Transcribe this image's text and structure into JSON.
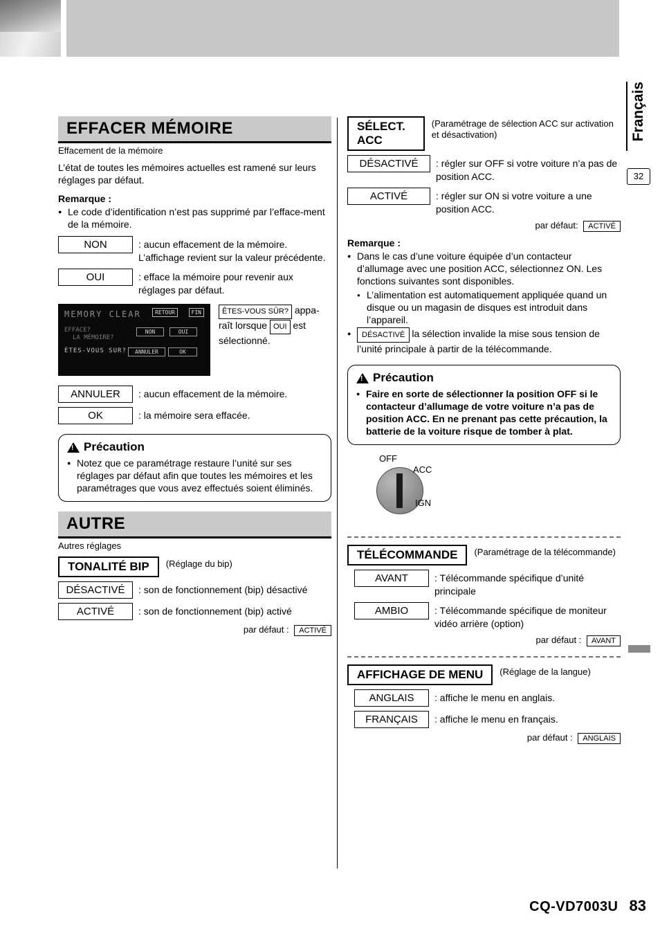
{
  "page": {
    "language_tab": "Français",
    "side_page_number": "32",
    "model": "CQ-VD7003U",
    "page_number": "83"
  },
  "left": {
    "section1": {
      "title": "EFFACER MÉMOIRE",
      "subtitle": "Effacement de la mémoire",
      "body": "L’état de toutes les mémoires actuelles est ramené sur leurs réglages par défaut.",
      "remarque_label": "Remarque :",
      "remarque_items": [
        "Le code d’identification n’est pas supprimé par l’efface-ment de la mémoire."
      ],
      "options": [
        {
          "label": "NON",
          "desc": ": aucun effacement de la mémoire. L’affichage revient sur la valeur précédente."
        },
        {
          "label": "OUI",
          "desc": ": efface la mémoire pour revenir aux réglages par défaut."
        }
      ],
      "lcd": {
        "title": "MEMORY CLEAR",
        "btn_retour": "RETOUR",
        "btn_fin": "FIN",
        "line1": "EFFACE?",
        "line2": "LA MÉMOIRE?",
        "line3": "ÉTES-VOUS SUR?",
        "btn_non": "NON",
        "btn_oui": "OUI",
        "btn_annuler": "ANNULER",
        "btn_ok": "OK"
      },
      "lcd_caption": {
        "box1": "ÊTES-VOUS SÛR?",
        "text1": "appa-raît lorsque",
        "box2": "OUI",
        "text2": "est sélectionné."
      },
      "options2": [
        {
          "label": "ANNULER",
          "desc": ": aucun effacement de la mémoire."
        },
        {
          "label": "OK",
          "desc": ": la mémoire sera effacée."
        }
      ],
      "precaution": {
        "title": "Précaution",
        "items": [
          "Notez que ce paramétrage restaure l’unité sur ses réglages par défaut afin que toutes les mémoires et les paramétrages que vous avez effectués soient éliminés."
        ]
      }
    },
    "section2": {
      "title": "AUTRE",
      "subtitle": "Autres réglages",
      "setting": {
        "name": "TONALITÉ BIP",
        "note": "(Réglage du bip)",
        "options": [
          {
            "label": "DÉSACTIVÉ",
            "desc": ": son de fonctionnement (bip) désactivé"
          },
          {
            "label": "ACTIVÉ",
            "desc": ": son de fonctionnement (bip) activé"
          }
        ],
        "default_label": "par défaut :",
        "default_value": "ACTIVÉ"
      }
    }
  },
  "right": {
    "acc": {
      "name": "SÉLECT. ACC",
      "note": "(Paramétrage de sélection ACC sur activation et désactivation)",
      "options": [
        {
          "label": "DÉSACTIVÉ",
          "desc": ": régler sur OFF si votre voiture n’a pas de position ACC."
        },
        {
          "label": "ACTIVÉ",
          "desc": ": régler sur ON si votre voiture a une position ACC."
        }
      ],
      "default_label": "par défaut:",
      "default_value": "ACTIVÉ",
      "remarque_label": "Remarque :",
      "remarque_items": [
        {
          "level": 1,
          "text": "Dans le cas d’une voiture équipée d’un contacteur d’allumage avec une position ACC, sélectionnez ON. Les fonctions suivantes sont disponibles."
        },
        {
          "level": 2,
          "text": "L’alimentation est automatiquement appliquée quand un disque ou un magasin de disques est introduit dans l’appareil."
        },
        {
          "level": 1,
          "text": "la sélection invalide la mise sous tension de l’unité principale à partir de la télécommande.",
          "inline_box": "DÉSACTIVÉ"
        }
      ],
      "precaution": {
        "title": "Précaution",
        "items": [
          "Faire en sorte de sélectionner la position OFF si le contacteur d’allumage de votre voiture n’a pas de position ACC. En ne prenant pas cette précaution, la batterie de la voiture risque de tomber à plat."
        ]
      },
      "knob_labels": {
        "off": "OFF",
        "acc": "ACC",
        "ign": "IGN"
      }
    },
    "remote": {
      "name": "TÉLÉCOMMANDE",
      "note": "(Paramétrage de la télécommande)",
      "options": [
        {
          "label": "AVANT",
          "desc": ": Télécommande spécifique d’unité principale"
        },
        {
          "label": "AMBIO",
          "desc": ": Télécommande spécifique de moniteur vidéo arrière (option)"
        }
      ],
      "default_label": "par défaut :",
      "default_value": "AVANT"
    },
    "menu": {
      "name": "AFFICHAGE DE MENU",
      "note": "(Réglage de la langue)",
      "options": [
        {
          "label": "ANGLAIS",
          "desc": ": affiche le menu en anglais."
        },
        {
          "label": "FRANÇAIS",
          "desc": ": affiche le menu en français."
        }
      ],
      "default_label": "par défaut :",
      "default_value": "ANGLAIS"
    }
  }
}
